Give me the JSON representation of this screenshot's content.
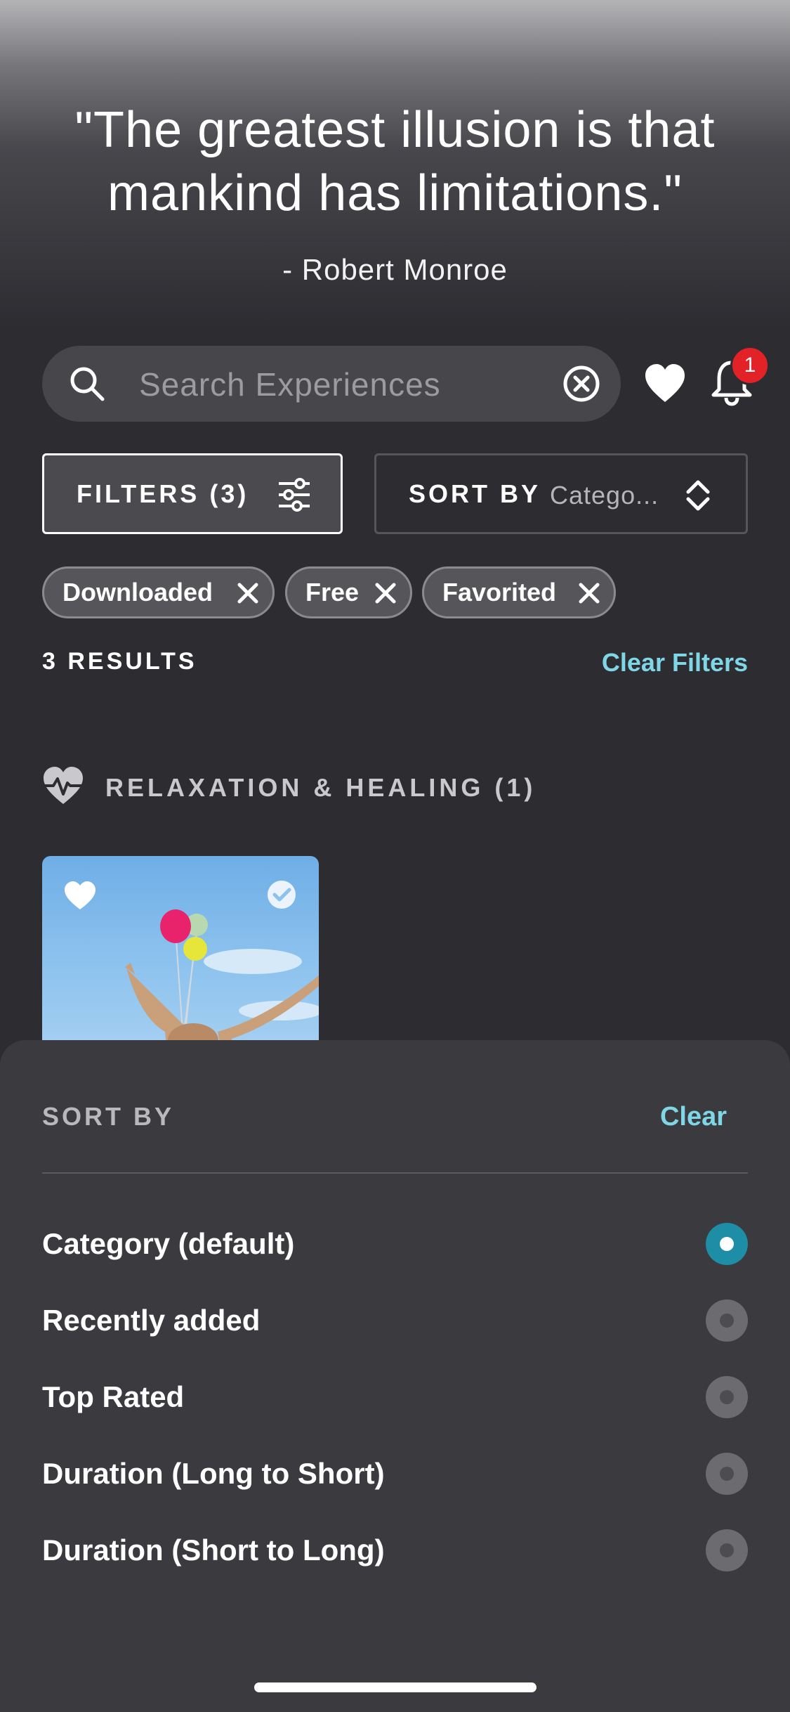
{
  "header": {
    "quote": "\"The greatest illusion is that mankind has limitations.\"",
    "author": "- Robert Monroe"
  },
  "search": {
    "placeholder": "Search Experiences"
  },
  "notifications": {
    "badge_count": "1"
  },
  "filters_button": {
    "label": "FILTERS (3)"
  },
  "sort_button": {
    "label": "SORT BY",
    "value": "Catego..."
  },
  "chips": [
    {
      "label": "Downloaded"
    },
    {
      "label": "Free"
    },
    {
      "label": "Favorited"
    }
  ],
  "results": {
    "count_label": "3 RESULTS",
    "clear_filters": "Clear Filters"
  },
  "category": {
    "title": "RELAXATION & HEALING (1)"
  },
  "sort_sheet": {
    "title": "SORT BY",
    "clear": "Clear",
    "options": [
      {
        "label": "Category (default)",
        "selected": true
      },
      {
        "label": "Recently added",
        "selected": false
      },
      {
        "label": "Top Rated",
        "selected": false
      },
      {
        "label": "Duration (Long to Short)",
        "selected": false
      },
      {
        "label": "Duration (Short to Long)",
        "selected": false
      }
    ]
  },
  "colors": {
    "background": "#2c2c31",
    "accent": "#7fd6e6",
    "selected_radio": "#1d8ea6",
    "badge": "#e32227"
  }
}
